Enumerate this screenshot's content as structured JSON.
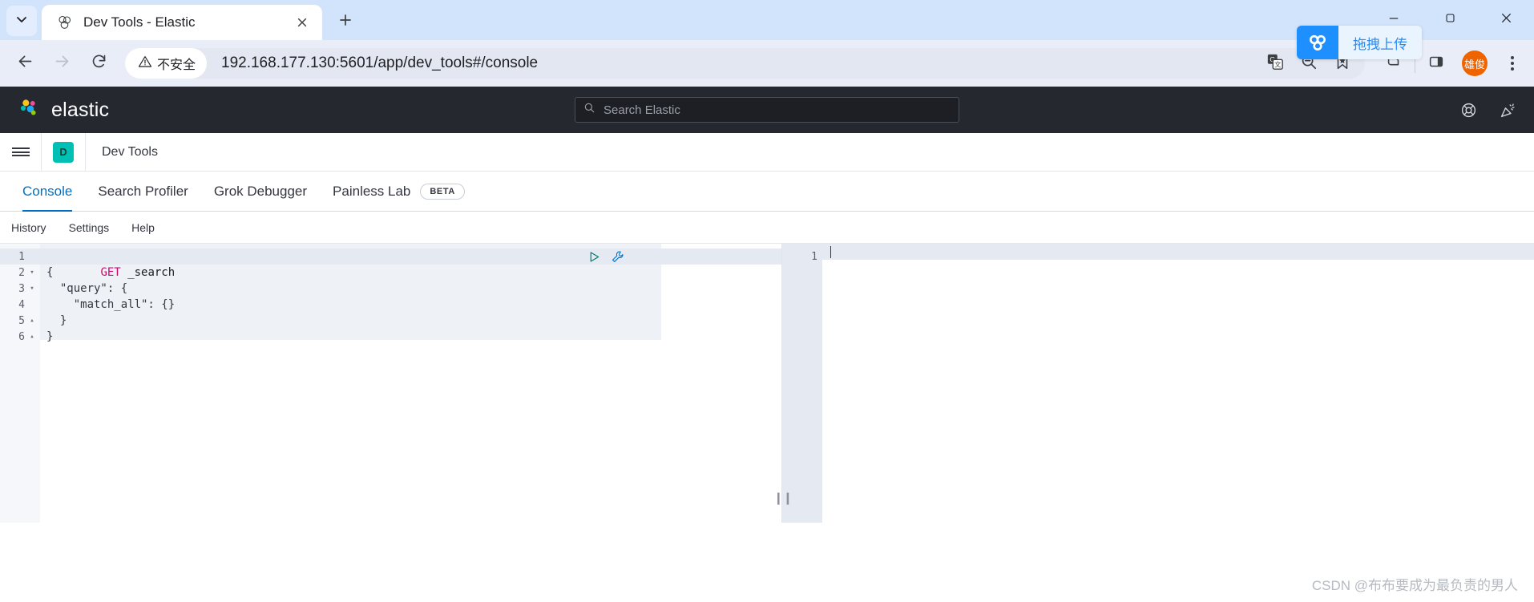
{
  "browser": {
    "tab": {
      "title": "Dev Tools - Elastic",
      "favicon_icon": "elastic-favicon",
      "close_icon": "close-icon"
    },
    "tab_list_icon": "chevron-down-icon",
    "new_tab_icon": "plus-icon",
    "window_controls": {
      "minimize": "minimize-icon",
      "maximize": "maximize-icon",
      "close": "window-close-icon"
    },
    "nav": {
      "back_icon": "back-arrow-icon",
      "forward_icon": "forward-arrow-icon",
      "reload_icon": "reload-icon"
    },
    "omnibox": {
      "security_label": "不安全",
      "security_icon": "warning-triangle-icon",
      "url": "192.168.177.130:5601/app/dev_tools#/console",
      "translate_icon": "google-translate-icon",
      "zoom_out_icon": "zoom-out-icon",
      "bookmark_icon": "bookmark-star-icon"
    },
    "extensions": {
      "ext1_icon": "extension-icon",
      "ext2_icon": "sidepanel-icon"
    },
    "profile_initials": "雄俊",
    "menu_icon": "three-dot-menu-icon",
    "netdisk_chip": {
      "label": "拖拽上传",
      "icon": "baidu-netdisk-icon",
      "bg": "#1e8fff",
      "label_bg": "#e9f4ff",
      "label_color": "#2b8cf0"
    }
  },
  "elastic": {
    "brand": "elastic",
    "brand_icon": "elastic-logo-icon",
    "search": {
      "placeholder": "Search Elastic",
      "icon": "search-icon"
    },
    "header_icons": {
      "help": "help-ring-icon",
      "news": "party-popper-icon"
    },
    "header_bg": "#25282f"
  },
  "breadcrumb": {
    "menu_icon": "hamburger-menu-icon",
    "badge": "D",
    "badge_color": "#00bfb3",
    "title": "Dev Tools"
  },
  "tabs": [
    {
      "label": "Console",
      "active": true,
      "badge": null
    },
    {
      "label": "Search Profiler",
      "active": false,
      "badge": null
    },
    {
      "label": "Grok Debugger",
      "active": false,
      "badge": null
    },
    {
      "label": "Painless Lab",
      "active": false,
      "badge": "BETA"
    }
  ],
  "console_menu": [
    {
      "label": "History"
    },
    {
      "label": "Settings"
    },
    {
      "label": "Help"
    }
  ],
  "editor": {
    "gutter": [
      {
        "num": "1",
        "fold": ""
      },
      {
        "num": "2",
        "fold": "▾"
      },
      {
        "num": "3",
        "fold": "▾"
      },
      {
        "num": "4",
        "fold": ""
      },
      {
        "num": "5",
        "fold": "▴"
      },
      {
        "num": "6",
        "fold": "▴"
      }
    ],
    "lines": [
      {
        "method": "GET",
        "rest": " _search"
      },
      {
        "text": "{"
      },
      {
        "text": "  \"query\": {"
      },
      {
        "text": "    \"match_all\": {}"
      },
      {
        "text": "  }"
      },
      {
        "text": "}"
      }
    ],
    "play_icon": "play-request-icon",
    "wrench_icon": "wrench-icon",
    "resize_handle_icon": "resize-handle-icon"
  },
  "output": {
    "gutter": [
      {
        "num": "1"
      }
    ]
  },
  "watermark": "CSDN @布布要成为最负责的男人"
}
